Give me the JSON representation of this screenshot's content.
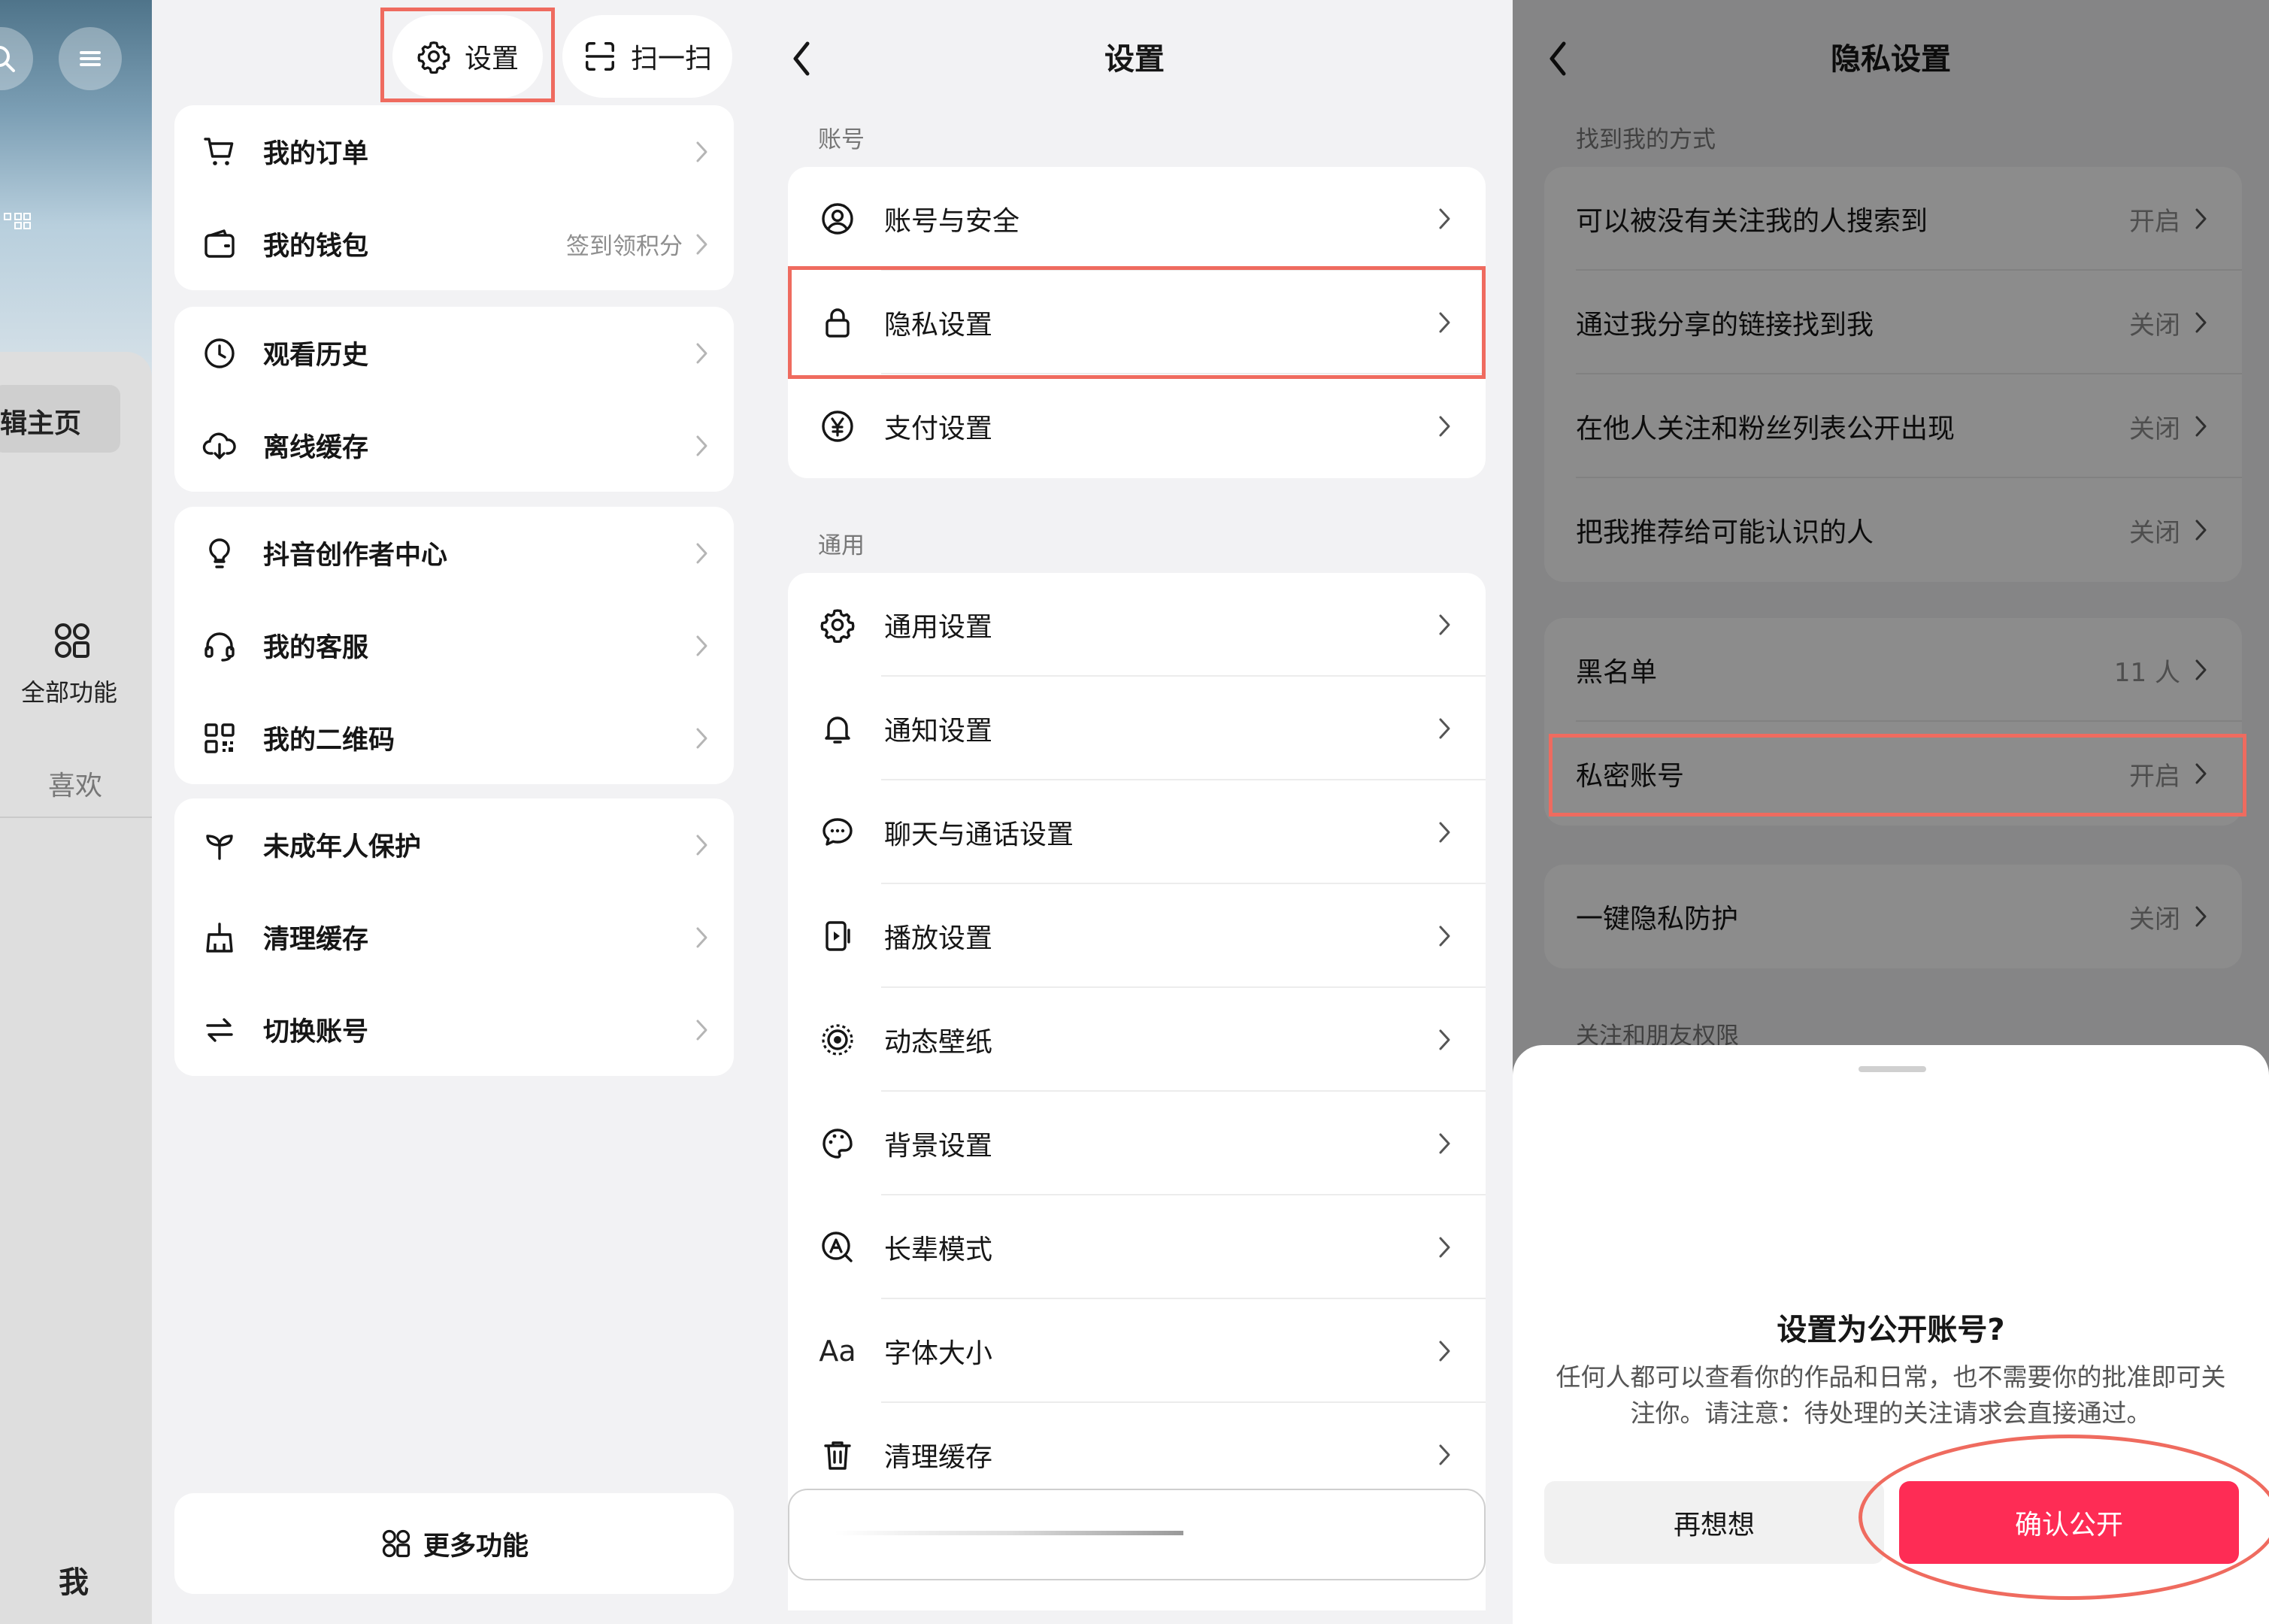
{
  "panel1": {
    "strip": {
      "edit_label": "辑主页",
      "all_features_label": "全部功能",
      "like_label": "喜欢",
      "me_label": "我"
    },
    "top_buttons": {
      "settings_label": "设置",
      "scan_label": "扫一扫"
    },
    "menu_groups": [
      [
        {
          "label": "我的订单",
          "sub": "",
          "icon": "cart-icon"
        },
        {
          "label": "我的钱包",
          "sub": "签到领积分",
          "icon": "wallet-icon"
        }
      ],
      [
        {
          "label": "观看历史",
          "sub": "",
          "icon": "clock-icon"
        },
        {
          "label": "离线缓存",
          "sub": "",
          "icon": "cloud-download-icon"
        }
      ],
      [
        {
          "label": "抖音创作者中心",
          "sub": "",
          "icon": "lightbulb-icon"
        },
        {
          "label": "我的客服",
          "sub": "",
          "icon": "headset-icon"
        },
        {
          "label": "我的二维码",
          "sub": "",
          "icon": "qrcode-icon"
        }
      ],
      [
        {
          "label": "未成年人保护",
          "sub": "",
          "icon": "sprout-icon"
        },
        {
          "label": "清理缓存",
          "sub": "",
          "icon": "broom-icon"
        },
        {
          "label": "切换账号",
          "sub": "",
          "icon": "switch-icon"
        }
      ]
    ],
    "more_label": "更多功能"
  },
  "panel2": {
    "title": "设置",
    "account_section": "账号",
    "account_items": [
      {
        "label": "账号与安全",
        "icon": "user-circle-icon"
      },
      {
        "label": "隐私设置",
        "icon": "lock-icon"
      },
      {
        "label": "支付设置",
        "icon": "yen-icon"
      }
    ],
    "general_section": "通用",
    "general_items": [
      {
        "label": "通用设置",
        "icon": "gear-icon"
      },
      {
        "label": "通知设置",
        "icon": "bell-icon"
      },
      {
        "label": "聊天与通话设置",
        "icon": "chat-icon"
      },
      {
        "label": "播放设置",
        "icon": "play-icon"
      },
      {
        "label": "动态壁纸",
        "icon": "wallpaper-icon"
      },
      {
        "label": "背景设置",
        "icon": "palette-icon"
      },
      {
        "label": "长辈模式",
        "icon": "elder-icon"
      },
      {
        "label": "字体大小",
        "icon": "font-size-icon",
        "glyph": "Aa"
      },
      {
        "label": "清理缓存",
        "icon": "trash-icon"
      }
    ]
  },
  "panel3": {
    "title": "隐私设置",
    "section1": "找到我的方式",
    "find_items": [
      {
        "label": "可以被没有关注我的人搜索到",
        "value": "开启"
      },
      {
        "label": "通过我分享的链接找到我",
        "value": "关闭"
      },
      {
        "label": "在他人关注和粉丝列表公开出现",
        "value": "关闭"
      },
      {
        "label": "把我推荐给可能认识的人",
        "value": "关闭"
      }
    ],
    "blacklist": {
      "label": "黑名单",
      "value": "11 人"
    },
    "private_account": {
      "label": "私密账号",
      "value": "开启"
    },
    "one_key": {
      "label": "一键隐私防护",
      "value": "关闭"
    },
    "section2": "关注和朋友权限",
    "dialog": {
      "title": "设置为公开账号?",
      "body": "任何人都可以查看你的作品和日常，也不需要你的批准即可关注你。请注意：待处理的关注请求会直接通过。",
      "cancel_label": "再想想",
      "confirm_label": "确认公开"
    }
  },
  "colors": {
    "accent": "#fe2c55",
    "highlight": "#ef6b5f"
  }
}
